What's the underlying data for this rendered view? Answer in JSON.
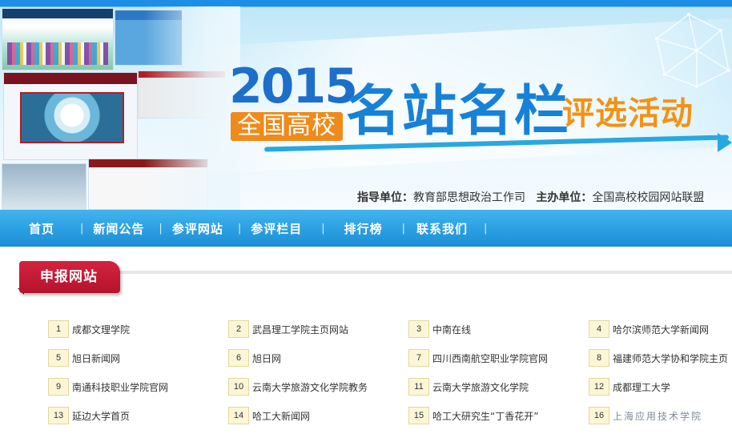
{
  "banner": {
    "year": "2015",
    "nation_label": "全国高校",
    "title_main": "名站名栏",
    "title_sub": "评选活动",
    "sponsors": {
      "guide_label": "指导单位：",
      "guide_value": "教育部思想政治工作司",
      "host_label": "主办单位：",
      "host_value": "全国高校校园网站联盟"
    }
  },
  "nav": {
    "items": [
      {
        "label": "首页"
      },
      {
        "label": "新闻公告"
      },
      {
        "label": "参评网站"
      },
      {
        "label": "参评栏目"
      },
      {
        "label": "排行榜"
      },
      {
        "label": "联系我们"
      }
    ],
    "separator": "|"
  },
  "section": {
    "title": "申报网站"
  },
  "sites": [
    {
      "num": "1",
      "name": "成都文理学院"
    },
    {
      "num": "2",
      "name": "武昌理工学院主页网站"
    },
    {
      "num": "3",
      "name": "中南在线"
    },
    {
      "num": "4",
      "name": "哈尔滨师范大学新闻网"
    },
    {
      "num": "5",
      "name": "旭日新闻网"
    },
    {
      "num": "6",
      "name": "旭日网"
    },
    {
      "num": "7",
      "name": "四川西南航空职业学院官网"
    },
    {
      "num": "8",
      "name": "福建师范大学协和学院主页"
    },
    {
      "num": "9",
      "name": "南通科技职业学院官网"
    },
    {
      "num": "10",
      "name": "云南大学旅游文化学院教务"
    },
    {
      "num": "11",
      "name": "云南大学旅游文化学院"
    },
    {
      "num": "12",
      "name": "成都理工大学"
    },
    {
      "num": "13",
      "name": "延边大学首页"
    },
    {
      "num": "14",
      "name": "哈工大新闻网"
    },
    {
      "num": "15",
      "name": "哈工大研究生“丁香花开”"
    },
    {
      "num": "16",
      "name": "上海应用技术学院"
    }
  ],
  "colors": {
    "nav_bg": "#2a9fe2",
    "ribbon_red": "#c41a35",
    "year_blue": "#1d6fc9",
    "accent_orange": "#f39213"
  }
}
